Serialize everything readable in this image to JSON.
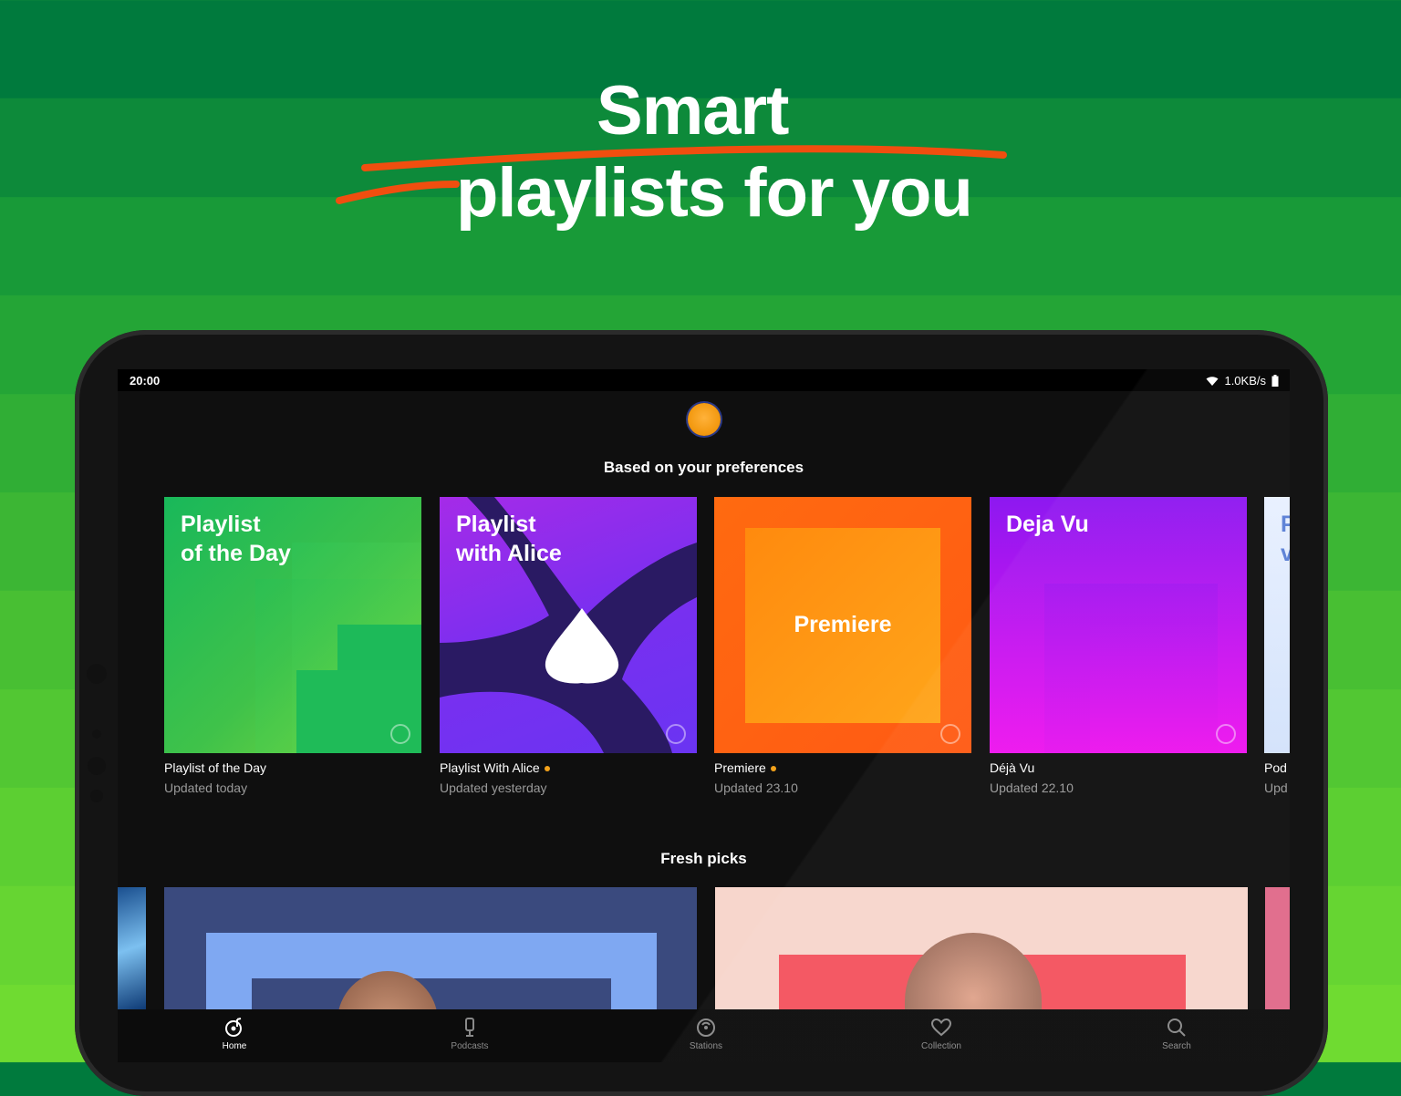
{
  "headline": {
    "line1": "Smart",
    "line2": "playlists for you"
  },
  "status_bar": {
    "time": "20:00",
    "speed": "1.0KB/s"
  },
  "sections": {
    "preferences_title": "Based on your preferences",
    "fresh_title": "Fresh picks"
  },
  "playlists": [
    {
      "cover_title": "Playlist\nof the Day",
      "name": "Playlist of the Day",
      "updated": "Updated today",
      "new": false
    },
    {
      "cover_title": "Playlist\nwith Alice",
      "name": "Playlist With Alice",
      "updated": "Updated yesterday",
      "new": true
    },
    {
      "cover_title": "Premiere",
      "name": "Premiere",
      "updated": "Updated 23.10",
      "new": true
    },
    {
      "cover_title": "Deja Vu",
      "name": "Déjà Vu",
      "updated": "Updated 22.10",
      "new": false
    },
    {
      "cover_title": "P\nv",
      "name": "Pod",
      "updated": "Upd",
      "new": false
    }
  ],
  "bottom_nav": [
    {
      "label": "Home",
      "icon": "home-note-icon",
      "active": true
    },
    {
      "label": "Podcasts",
      "icon": "microphone-icon",
      "active": false
    },
    {
      "label": "Stations",
      "icon": "radio-icon",
      "active": false
    },
    {
      "label": "Collection",
      "icon": "heart-icon",
      "active": false
    },
    {
      "label": "Search",
      "icon": "search-icon",
      "active": false
    }
  ],
  "colors": {
    "accent_underline": "#f04e0f",
    "new_dot": "#f3a21b",
    "avatar": "#f39a12"
  }
}
